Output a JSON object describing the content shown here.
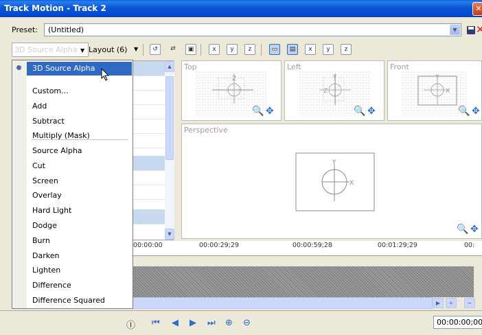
{
  "window": {
    "title": "Track Motion - Track 2"
  },
  "preset": {
    "label": "Preset:",
    "value": "(Untitled)"
  },
  "toolbar": {
    "blend_mode_value": "3D Source Alpha",
    "layout_label": "Layout (6)"
  },
  "viewports": {
    "top": "Top",
    "left": "Left",
    "front": "Front",
    "perspective": "Perspective",
    "y": "Y",
    "z": "Z",
    "x": "X"
  },
  "timeline": {
    "ticks": [
      "00:00:00",
      "00:00:29;29",
      "00:00:59;28",
      "00:01:29;29",
      "00:"
    ]
  },
  "bottom": {
    "timecode": "00:00:00;00"
  },
  "dropdown": {
    "selected": "3D Source Alpha",
    "items": [
      "Custom...",
      "Add",
      "Subtract",
      "Multiply (Mask)",
      "Source Alpha",
      "Cut",
      "Screen",
      "Overlay",
      "Hard Light",
      "Dodge",
      "Burn",
      "Darken",
      "Lighten",
      "Difference",
      "Difference Squared"
    ]
  },
  "colors": {
    "title_bar": "#0a5fd8",
    "selection": "#316ac5",
    "dialog_bg": "#ece9d8"
  }
}
